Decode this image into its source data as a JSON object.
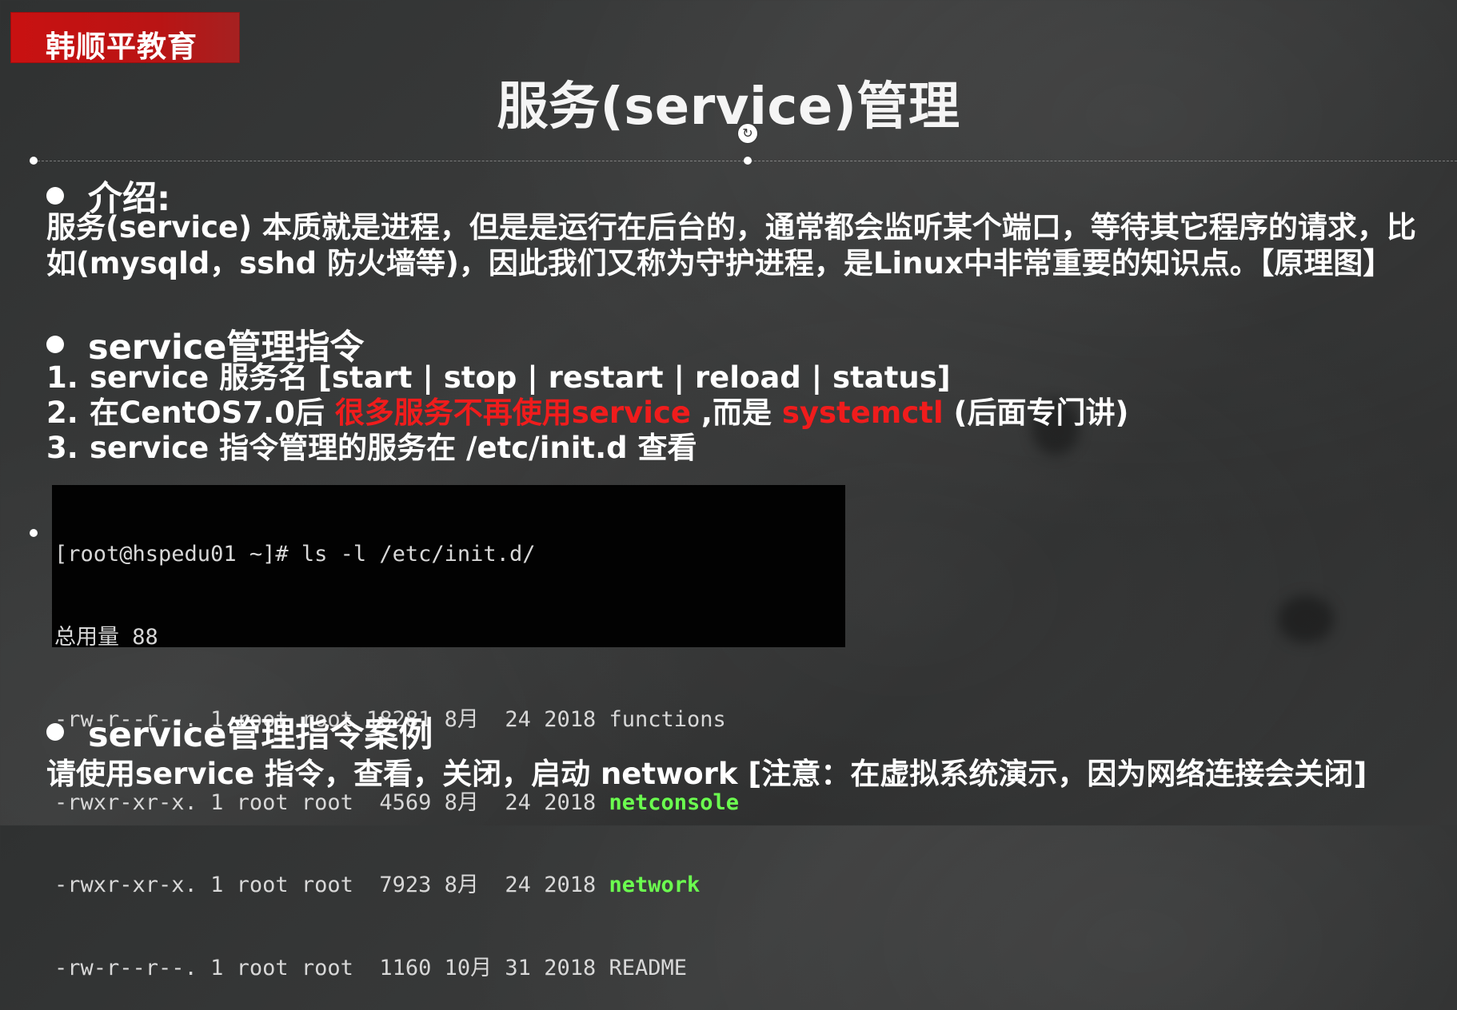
{
  "brand": {
    "label": "韩顺平教育"
  },
  "slide": {
    "title": "服务(service)管理"
  },
  "intro": {
    "heading": "介绍:",
    "line1": "服务(service) 本质就是进程，但是是运行在后台的，通常都会监听某个端口，等待其它程序的请求，比",
    "line2": "如(mysqld，sshd 防火墙等)，因此我们又称为守护进程，是Linux中非常重要的知识点。【原理图】"
  },
  "commands": {
    "heading": "service管理指令",
    "step1": {
      "number": "1.",
      "text": "service 服务名 [start | stop | restart | reload | status]"
    },
    "step2": {
      "number": "2.",
      "before": "在CentOS7.0后 ",
      "highlight1": "很多服务不再使用service",
      "middle": " ,而是 ",
      "highlight2": "systemctl",
      "after": " (后面专门讲)"
    },
    "step3": {
      "number": "3.",
      "text": "service 指令管理的服务在 /etc/init.d 查看"
    }
  },
  "terminal": {
    "prompt": "[root@hspedu01 ~]# ls -l /etc/init.d/",
    "total": "总用量 88",
    "rows": [
      {
        "meta": "-rw-r--r--. 1 root root 18281 8月  24 2018 ",
        "name": "functions",
        "executable": false
      },
      {
        "meta": "-rwxr-xr-x. 1 root root  4569 8月  24 2018 ",
        "name": "netconsole",
        "executable": true
      },
      {
        "meta": "-rwxr-xr-x. 1 root root  7923 8月  24 2018 ",
        "name": "network",
        "executable": true
      },
      {
        "meta": "-rw-r--r--. 1 root root  1160 10月 31 2018 ",
        "name": "README",
        "executable": false
      }
    ]
  },
  "example": {
    "heading": "service管理指令案例",
    "text": "请使用service 指令，查看，关闭，启动 network [注意：在虚拟系统演示，因为网络连接会关闭]"
  },
  "colors": {
    "background": "#333535",
    "brand": "#c91111",
    "highlight": "#f01c1c",
    "terminal_green": "#6bff4f"
  }
}
